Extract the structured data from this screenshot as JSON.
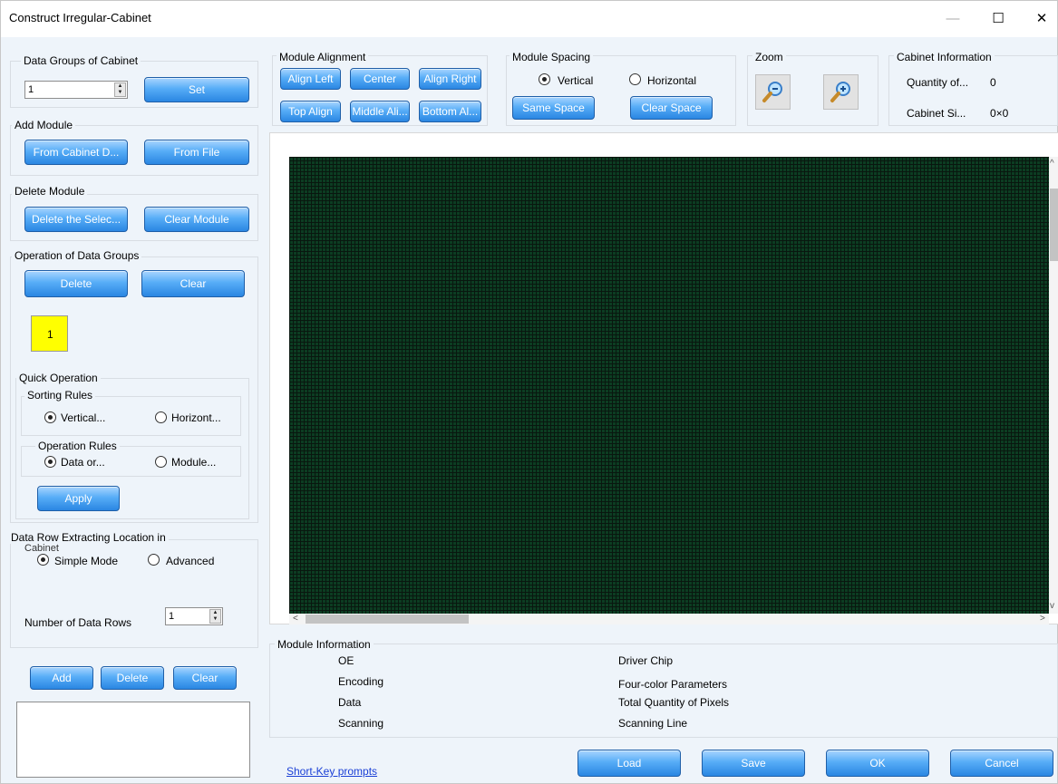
{
  "window": {
    "title": "Construct Irregular-Cabinet",
    "minimize": "—",
    "maximize": "☐",
    "close": "✕"
  },
  "data_groups": {
    "legend": "Data Groups of Cabinet",
    "value": "1",
    "set_label": "Set"
  },
  "add_module": {
    "legend": "Add Module",
    "from_cabinet_label": "From Cabinet D...",
    "from_file_label": "From File"
  },
  "delete_module": {
    "legend": "Delete Module",
    "delete_selected_label": "Delete the Selec...",
    "clear_module_label": "Clear Module"
  },
  "operation_groups": {
    "legend": "Operation of Data Groups",
    "delete_label": "Delete",
    "clear_label": "Clear",
    "group_item": "1",
    "group_item_color": "#ffff00",
    "quick_operation": {
      "legend": "Quick Operation",
      "sorting_rules": {
        "legend": "Sorting Rules",
        "vertical_label": "Vertical...",
        "horizontal_label": "Horizont...",
        "selected": "vertical"
      },
      "operation_rules": {
        "legend": "Operation Rules",
        "data_label": "Data or...",
        "module_label": "Module...",
        "selected": "data"
      },
      "apply_label": "Apply"
    }
  },
  "data_row": {
    "legend_line1": "Data Row Extracting Location in",
    "legend_line2": "Cabinet",
    "simple_mode_label": "Simple Mode",
    "advanced_label": "Advanced",
    "selected": "simple",
    "rows_label": "Number of Data Rows",
    "rows_value": "1",
    "add_label": "Add",
    "delete_label": "Delete",
    "clear_label": "Clear"
  },
  "module_alignment": {
    "legend": "Module Alignment",
    "align_left": "Align Left",
    "center": "Center",
    "align_right": "Align Right",
    "top_align": "Top Align",
    "middle_align": "Middle Ali...",
    "bottom_align": "Bottom Al..."
  },
  "module_spacing": {
    "legend": "Module Spacing",
    "vertical_label": "Vertical",
    "horizontal_label": "Horizontal",
    "selected": "vertical",
    "same_space": "Same Space",
    "clear_space": "Clear Space"
  },
  "zoom": {
    "legend": "Zoom",
    "zoom_out_icon": "zoom-out-icon",
    "zoom_in_icon": "zoom-in-icon"
  },
  "cabinet_info": {
    "legend": "Cabinet Information",
    "quantity_label": "Quantity of...",
    "quantity_value": "0",
    "size_label": "Cabinet Si...",
    "size_value": "0×0"
  },
  "canvas": {
    "grid_color": "#0c3d22",
    "scroll_left": "<",
    "scroll_right": ">",
    "scroll_up": "^",
    "scroll_down": "v"
  },
  "module_info": {
    "legend": "Module Information",
    "oe": "OE",
    "encoding": "Encoding",
    "data": "Data",
    "scanning": "Scanning",
    "driver_chip": "Driver Chip",
    "four_color": "Four-color Parameters",
    "total_pixels": "Total Quantity of Pixels",
    "scanning_line": "Scanning Line"
  },
  "footer": {
    "short_key": "Short-Key prompts",
    "load": "Load",
    "save": "Save",
    "ok": "OK",
    "cancel": "Cancel"
  },
  "colors": {
    "button_blue": "#3a93ec",
    "link_blue": "#1a3fd6",
    "panel_bg": "#eef4fa"
  }
}
